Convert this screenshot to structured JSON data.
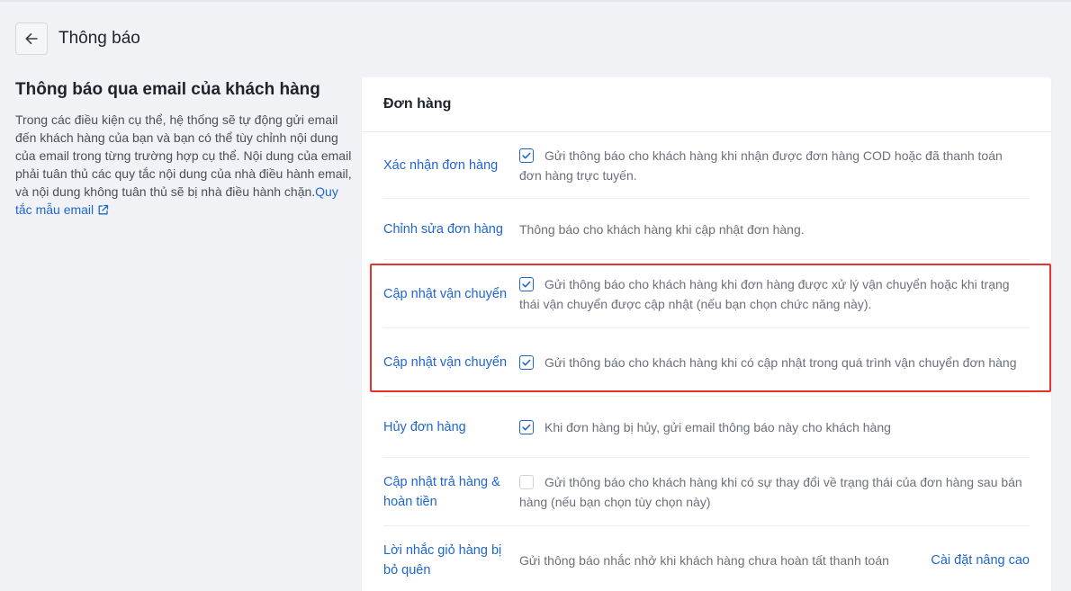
{
  "header": {
    "title": "Thông báo"
  },
  "intro": {
    "heading": "Thông báo qua email của khách hàng",
    "body": "Trong các điều kiện cụ thể, hệ thống sẽ tự động gửi email đến khách hàng của bạn và bạn có thể tùy chỉnh nội dung của email trong từng trường hợp cụ thể. Nội dung của email phải tuân thủ các quy tắc nội dung của nhà điều hành email, và nội dung không tuân thủ sẽ bị nhà điều hành chặn.",
    "link": "Quy tắc mẫu email"
  },
  "card": {
    "title": "Đơn hàng",
    "rows": [
      {
        "title": "Xác nhận đơn hàng",
        "checkbox": true,
        "checked": true,
        "desc": "Gửi thông báo cho khách hàng khi nhận được đơn hàng COD hoặc đã thanh toán đơn hàng trực tuyến."
      },
      {
        "title": "Chỉnh sửa đơn hàng",
        "checkbox": false,
        "checked": false,
        "desc": "Thông báo cho khách hàng khi cập nhật đơn hàng."
      },
      {
        "title": "Cập nhật vận chuyển",
        "checkbox": true,
        "checked": true,
        "desc": "Gửi thông báo cho khách hàng khi đơn hàng được xử lý vận chuyển hoặc khi trạng thái vận chuyển được cập nhật (nếu bạn chọn chức năng này)."
      },
      {
        "title": "Cập nhật vận chuyển",
        "checkbox": true,
        "checked": true,
        "desc": "Gửi thông báo cho khách hàng khi có cập nhật trong quá trình vận chuyển đơn hàng"
      },
      {
        "title": "Hủy đơn hàng",
        "checkbox": true,
        "checked": true,
        "desc": "Khi đơn hàng bị hủy, gửi email thông báo này cho khách hàng"
      },
      {
        "title": "Cập nhật trả hàng & hoàn tiền",
        "checkbox": true,
        "checked": false,
        "desc": "Gửi thông báo cho khách hàng khi có sự thay đổi về trạng thái của đơn hàng sau bán hàng (nếu bạn chọn tùy chọn này)"
      },
      {
        "title": "Lời nhắc giỏ hàng bị bỏ quên",
        "checkbox": false,
        "checked": false,
        "desc": "Gửi thông báo nhắc nhở khi khách hàng chưa hoàn tất thanh toán",
        "action": "Cài đặt nâng cao"
      }
    ]
  },
  "colors": {
    "accent": "#1e66d0",
    "highlight": "#e8332a",
    "background": "#f0f2f5"
  },
  "icons": {
    "back": "arrow-left-icon",
    "external": "external-link-icon",
    "check": "check-icon"
  }
}
